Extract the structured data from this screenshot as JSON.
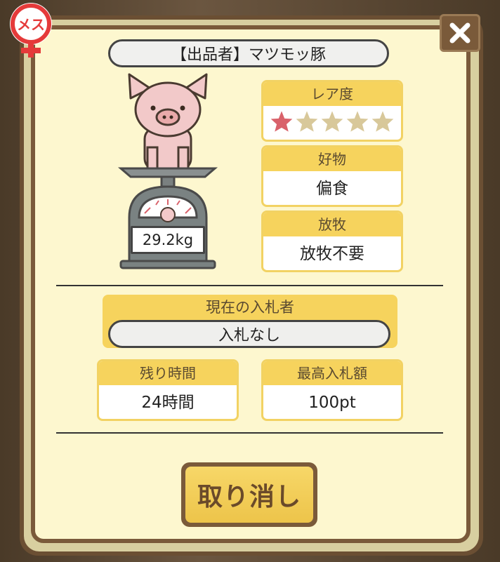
{
  "gender_badge": {
    "text": "メス",
    "color": "#e53a3a"
  },
  "seller": {
    "label": "【出品者】マツモッ豚"
  },
  "pig": {
    "weight": "29.2kg"
  },
  "rarity": {
    "title": "レア度",
    "stars_filled": 1,
    "stars_total": 5,
    "filled_color": "#d9626b",
    "empty_color": "#d8c89a"
  },
  "favorite": {
    "title": "好物",
    "value": "偏食"
  },
  "grazing": {
    "title": "放牧",
    "value": "放牧不要"
  },
  "bidder": {
    "title": "現在の入札者",
    "value": "入札なし"
  },
  "remaining": {
    "title": "残り時間",
    "value": "24時間"
  },
  "highest_bid": {
    "title": "最高入札額",
    "value": "100pt"
  },
  "cancel_button": {
    "label": "取り消し"
  },
  "close_icon": "close-icon"
}
